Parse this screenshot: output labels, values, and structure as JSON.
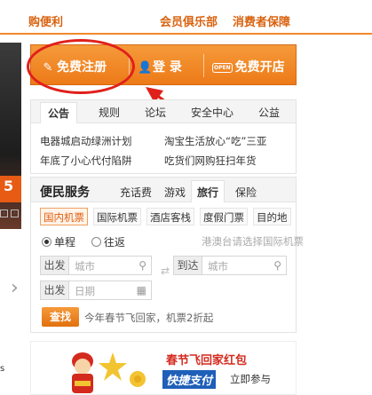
{
  "topbar": {
    "brand": "购便利",
    "links": [
      "会员俱乐部",
      "消费者保障"
    ],
    "accent": "#f28a2d"
  },
  "left_slice": {
    "banner_digit": "5",
    "pager_prev": "‹",
    "pager_next": "›",
    "arrow": "›",
    "bottom_mark": "s"
  },
  "action_bar": {
    "register_label": "免费注册",
    "login_label": "登 录",
    "open_shop_label": "免费开店",
    "shop_icon_text": "OPEN",
    "background": "#ef861f"
  },
  "annotation": {
    "color": "#e0201b"
  },
  "notice": {
    "tabs": [
      "公告",
      "规则",
      "论坛",
      "安全中心",
      "公益"
    ],
    "active_tab": "公告",
    "items": [
      [
        "电器城启动绿洲计划",
        "淘宝生活放心“吃”三亚"
      ],
      [
        "年底了小心代付陷阱",
        "吃货们网购狂扫年货"
      ]
    ]
  },
  "service": {
    "title": "便民服务",
    "tabs": [
      "充话费",
      "游戏",
      "旅行",
      "保险"
    ],
    "active_tab": "旅行",
    "subtabs": [
      "国内机票",
      "国际机票",
      "酒店客栈",
      "度假门票",
      "目的地"
    ],
    "active_subtab": "国内机票",
    "trip_one_way": "单程",
    "trip_round": "往返",
    "hint": "港澳台请选择国际机票",
    "depart_label": "出发",
    "depart_placeholder": "城市",
    "arrive_label": "到达",
    "arrive_placeholder": "城市",
    "date_label": "出发",
    "date_placeholder": "日期",
    "swap_icon": "⇄",
    "search_label": "查找",
    "search_tip": "今年春节飞回家，机票2折起"
  },
  "promo": {
    "title": "春节飞回家红包",
    "badge": "快捷支付",
    "cta": "立即参与"
  }
}
